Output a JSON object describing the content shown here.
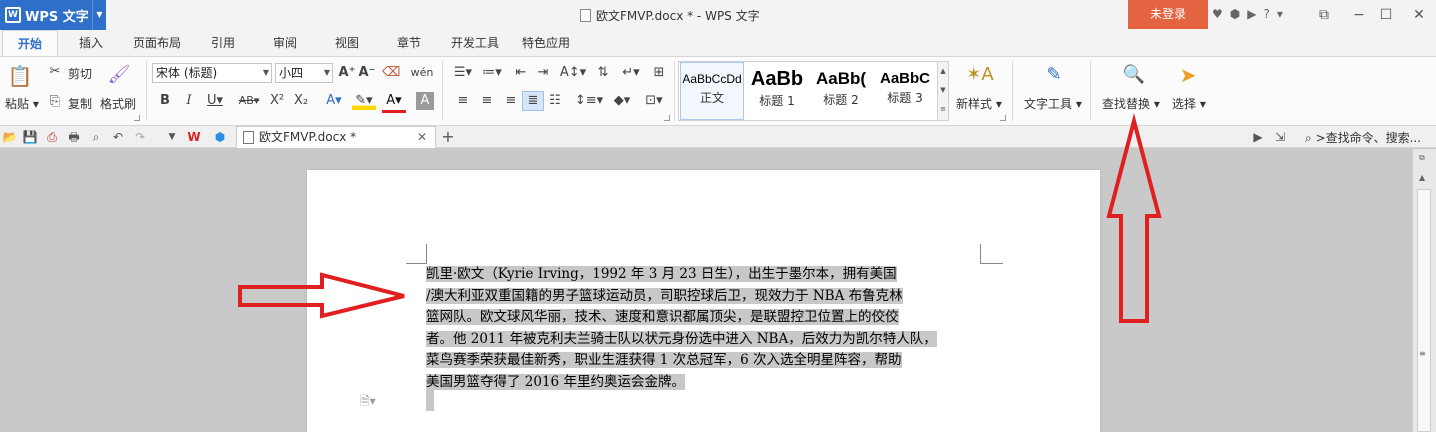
{
  "app": {
    "badge_logo": "W",
    "name": "WPS 文字",
    "window_title": "欧文FMVP.docx * - WPS 文字",
    "login_label": "未登录"
  },
  "tabs": [
    "开始",
    "插入",
    "页面布局",
    "引用",
    "审阅",
    "视图",
    "章节",
    "开发工具",
    "特色应用"
  ],
  "ribbon": {
    "paste_label": "粘贴",
    "cut_label": "剪切",
    "copy_label": "复制",
    "format_painter_label": "格式刷",
    "font_name": "宋体 (标题)",
    "font_size": "小四",
    "styles": [
      {
        "sample": "AaBbCcDd",
        "name": "正文"
      },
      {
        "sample": "AaBb",
        "name": "标题 1"
      },
      {
        "sample": "AaBb(",
        "name": "标题 2"
      },
      {
        "sample": "AaBbC",
        "name": "标题 3"
      }
    ],
    "new_style_label": "新样式",
    "text_tools_label": "文字工具",
    "find_replace_label": "查找替换",
    "select_label": "选择"
  },
  "doc_tab": {
    "title": "欧文FMVP.docx *"
  },
  "command_search": {
    "placeholder": ">查找命令、搜索..."
  },
  "document": {
    "lines": [
      "凯里·欧文（Kyrie Irving，1992 年 3 月 23 日生），出生于墨尔本，拥有美国",
      "/澳大利亚双重国籍的男子篮球运动员，司职控球后卫，现效力于 NBA 布鲁克林",
      "篮网队。欧文球风华丽，技术、速度和意识都属顶尖，是联盟控卫位置上的佼佼",
      "者。他 2011 年被克利夫兰骑士队以状元身份选中进入 NBA，后效力为凯尔特人队，",
      "菜鸟赛季荣获最佳新秀，职业生涯获得 1 次总冠军，6 次入选全明星阵容，帮助",
      "美国男篮夺得了 2016 年里约奥运会金牌。"
    ]
  },
  "colors": {
    "accent_blue": "#2d6fc9",
    "login_orange": "#e46441",
    "annotation_red": "#e02020",
    "selection_gray": "#c8c8c8"
  }
}
